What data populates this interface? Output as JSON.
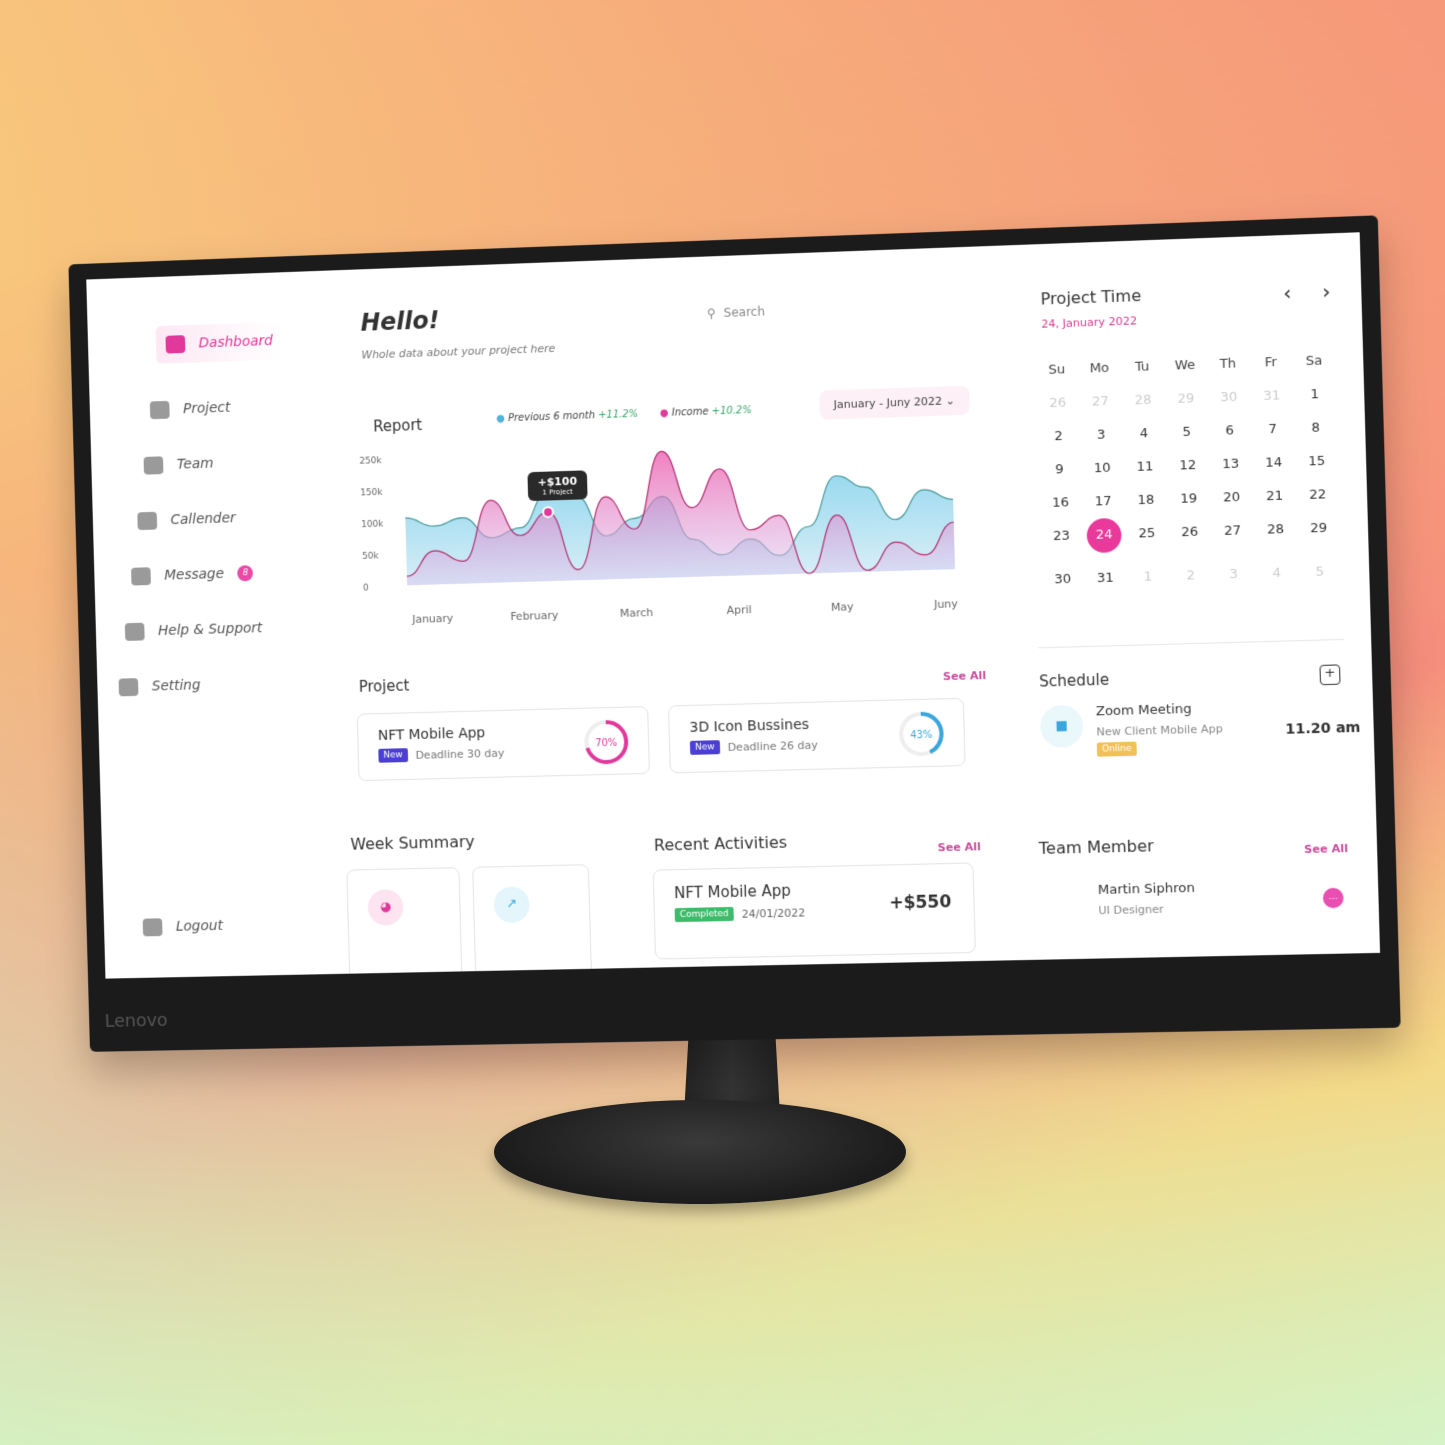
{
  "device": {
    "brand": "Lenovo"
  },
  "sidebar": {
    "items": [
      {
        "label": "Dashboard",
        "icon": "grid-icon",
        "active": true
      },
      {
        "label": "Project",
        "icon": "briefcase-icon"
      },
      {
        "label": "Team",
        "icon": "users-icon"
      },
      {
        "label": "Callender",
        "icon": "calendar-icon"
      },
      {
        "label": "Message",
        "icon": "chat-icon",
        "badge": "8"
      },
      {
        "label": "Help & Support",
        "icon": "info-icon"
      },
      {
        "label": "Setting",
        "icon": "gear-icon"
      }
    ],
    "logout": "Logout"
  },
  "header": {
    "title": "Hello!",
    "subtitle": "Whole data about your project here",
    "search_placeholder": "Search"
  },
  "report": {
    "title": "Report",
    "legend": [
      {
        "label": "Previous 6 month",
        "change": "+11.2%",
        "color": "#4fb3dd"
      },
      {
        "label": "Income",
        "change": "+10.2%",
        "color": "#e0399b"
      }
    ],
    "range": "January - Juny 2022",
    "tooltip": {
      "value": "+$100",
      "sub": "1 Project"
    }
  },
  "chart_data": {
    "type": "area",
    "x": [
      "January",
      "February",
      "March",
      "April",
      "May",
      "Juny"
    ],
    "yticks": [
      "250k",
      "150k",
      "100k",
      "50k",
      "0"
    ],
    "ylim": [
      0,
      250
    ],
    "series": [
      {
        "name": "Previous 6 month",
        "color": "#8fd3ec",
        "values": [
          90,
          78,
          88,
          60,
          72,
          118,
          112,
          58,
          80,
          108,
          50,
          28,
          48,
          25,
          62,
          128,
          112,
          68,
          106,
          92
        ]
      },
      {
        "name": "Income",
        "color": "#ec4fa8",
        "values": [
          12,
          45,
          30,
          110,
          62,
          92,
          14,
          110,
          66,
          168,
          92,
          142,
          60,
          78,
          0,
          76,
          2,
          38,
          20,
          62
        ]
      }
    ]
  },
  "projects": {
    "title": "Project",
    "see_all": "See All",
    "items": [
      {
        "name": "NFT Mobile App",
        "tag": "New",
        "deadline": "Deadline 30 day",
        "progress": 70,
        "progress_label": "70%",
        "color": "#e0399b"
      },
      {
        "name": "3D Icon Bussines",
        "tag": "New",
        "deadline": "Deadline 26 day",
        "progress": 43,
        "progress_label": "43%",
        "color": "#3aa6dc"
      }
    ]
  },
  "week_summary": {
    "title": "Week Summary"
  },
  "recent": {
    "title": "Recent Activities",
    "see_all": "See All",
    "items": [
      {
        "name": "NFT Mobile App",
        "status": "Completed",
        "date": "24/01/2022",
        "amount": "+$550"
      }
    ]
  },
  "calendar": {
    "title": "Project Time",
    "date": "24, January 2022",
    "weekdays": [
      "Su",
      "Mo",
      "Tu",
      "We",
      "Th",
      "Fr",
      "Sa"
    ],
    "days": [
      "26",
      "27",
      "28",
      "29",
      "30",
      "31",
      "1",
      "2",
      "3",
      "4",
      "5",
      "6",
      "7",
      "8",
      "9",
      "10",
      "11",
      "12",
      "13",
      "14",
      "15",
      "16",
      "17",
      "18",
      "19",
      "20",
      "21",
      "22",
      "23",
      "24",
      "25",
      "26",
      "27",
      "28",
      "29",
      "30",
      "31",
      "1",
      "2",
      "3",
      "4",
      "5"
    ],
    "selected": "24"
  },
  "schedule": {
    "title": "Schedule",
    "items": [
      {
        "title": "Zoom Meeting",
        "subtitle": "New Client Mobile App",
        "tag": "Online",
        "time": "11.20 am"
      }
    ]
  },
  "team": {
    "title": "Team Member",
    "see_all": "See All",
    "members": [
      {
        "name": "Martin Siphron",
        "role": "UI Designer"
      }
    ]
  }
}
